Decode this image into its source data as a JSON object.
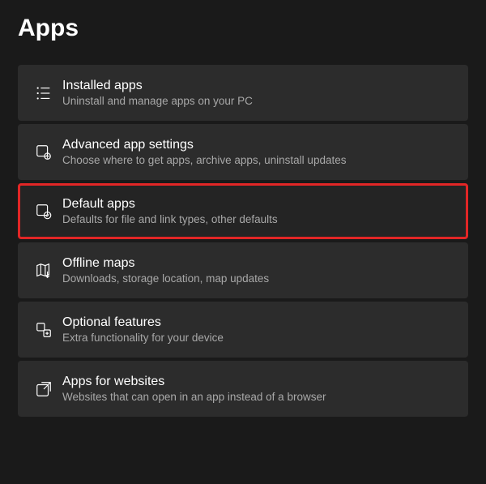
{
  "pageTitle": "Apps",
  "items": [
    {
      "title": "Installed apps",
      "subtitle": "Uninstall and manage apps on your PC",
      "icon": "list-icon",
      "highlighted": false
    },
    {
      "title": "Advanced app settings",
      "subtitle": "Choose where to get apps, archive apps, uninstall updates",
      "icon": "app-gear-icon",
      "highlighted": false
    },
    {
      "title": "Default apps",
      "subtitle": "Defaults for file and link types, other defaults",
      "icon": "app-check-icon",
      "highlighted": true
    },
    {
      "title": "Offline maps",
      "subtitle": "Downloads, storage location, map updates",
      "icon": "map-download-icon",
      "highlighted": false
    },
    {
      "title": "Optional features",
      "subtitle": "Extra functionality for your device",
      "icon": "add-square-icon",
      "highlighted": false
    },
    {
      "title": "Apps for websites",
      "subtitle": "Websites that can open in an app instead of a browser",
      "icon": "open-external-icon",
      "highlighted": false
    }
  ]
}
